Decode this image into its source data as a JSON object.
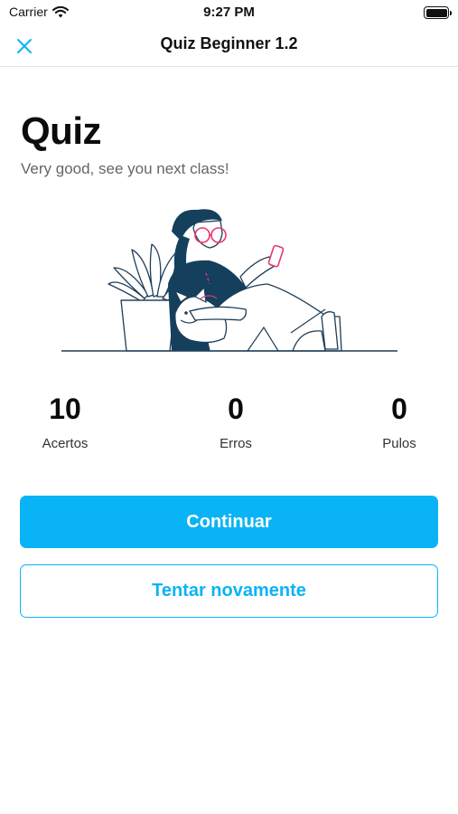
{
  "status_bar": {
    "carrier": "Carrier",
    "time": "9:27 PM",
    "wifi_icon": "wifi-icon",
    "battery_icon": "battery-icon"
  },
  "nav": {
    "title": "Quiz Beginner 1.2",
    "close_icon": "close-icon"
  },
  "main": {
    "title": "Quiz",
    "subtitle": "Very good, see you next class!",
    "illustration": "woman-with-phone-and-dog-illustration",
    "stats": [
      {
        "value": "10",
        "label": "Acertos"
      },
      {
        "value": "0",
        "label": "Erros"
      },
      {
        "value": "0",
        "label": "Pulos"
      }
    ]
  },
  "actions": {
    "continue_label": "Continuar",
    "retry_label": "Tentar novamente"
  },
  "colors": {
    "accent": "#0ab3f6",
    "illustration_line": "#1f3d57",
    "illustration_fill": "#14405e",
    "highlight": "#e8356b"
  }
}
